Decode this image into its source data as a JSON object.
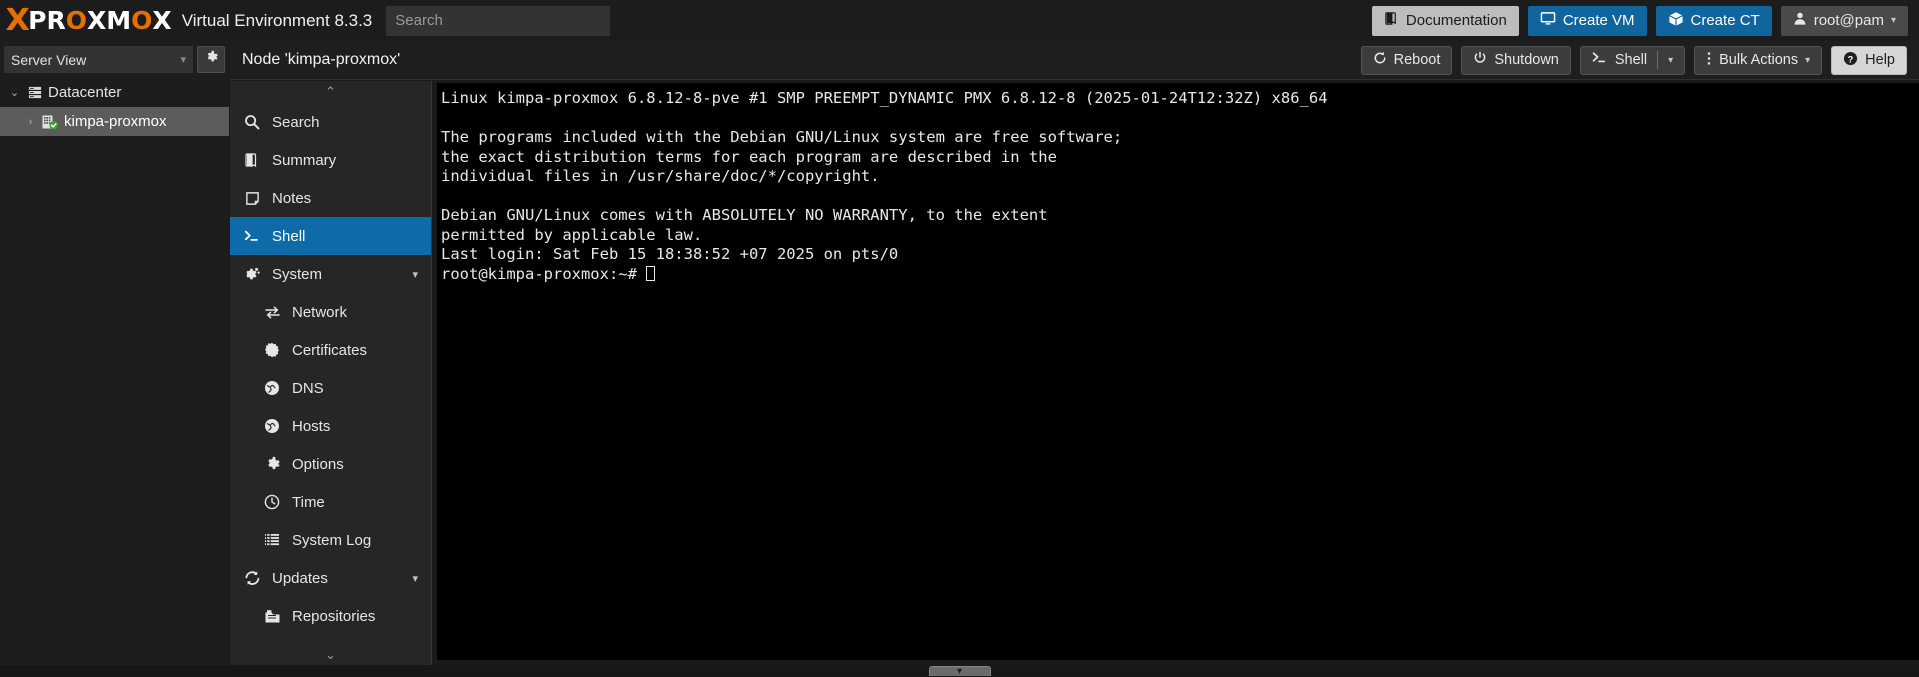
{
  "topbar": {
    "logo_mark": "X",
    "logo_word_parts": [
      {
        "text": "PR",
        "color": "white"
      },
      {
        "text": "O",
        "color": "orange"
      },
      {
        "text": "XM",
        "color": "white"
      },
      {
        "text": "O",
        "color": "orange"
      },
      {
        "text": "X",
        "color": "white"
      }
    ],
    "product_name": "Virtual Environment 8.3.3",
    "search": {
      "value": "",
      "placeholder": "Search"
    },
    "buttons": [
      {
        "label": "Documentation",
        "icon": "book-icon",
        "style": "gray"
      },
      {
        "label": "Create VM",
        "icon": "monitor-icon",
        "style": "blue"
      },
      {
        "label": "Create CT",
        "icon": "box-icon",
        "style": "blue"
      },
      {
        "label": "root@pam",
        "icon": "user-icon",
        "style": "dark",
        "caret": "▾"
      }
    ]
  },
  "tree": {
    "view_selector": {
      "label": "Server View",
      "chevron": "▾"
    },
    "settings_icon": "gear-icon",
    "items": [
      {
        "label": "Datacenter",
        "icon": "datacenter-icon",
        "arrow": "⌄",
        "level": 0,
        "selected": false
      },
      {
        "label": "kimpa-proxmox",
        "icon": "node-icon",
        "arrow": "›",
        "level": 1,
        "selected": true,
        "status": "online"
      }
    ]
  },
  "content": {
    "node_title": "Node 'kimpa-proxmox'",
    "actions": [
      {
        "label": "Reboot",
        "icon": "reboot-icon",
        "style": "dark",
        "split": false
      },
      {
        "label": "Shutdown",
        "icon": "power-icon",
        "style": "dark",
        "split": false
      },
      {
        "label": "Shell",
        "icon": "shell-icon",
        "style": "dark",
        "split": true,
        "caret": "▾"
      },
      {
        "label": "Bulk Actions",
        "icon": "kebab-icon",
        "style": "dark",
        "split": false,
        "caret": "▾"
      },
      {
        "label": "Help",
        "icon": "help-icon",
        "style": "light",
        "split": false
      }
    ]
  },
  "nav": {
    "scroll_up": "⌃",
    "scroll_down": "⌄",
    "items": [
      {
        "label": "Search",
        "icon": "search-icon",
        "sub": false,
        "active": false
      },
      {
        "label": "Summary",
        "icon": "summary-icon",
        "sub": false,
        "active": false
      },
      {
        "label": "Notes",
        "icon": "notes-icon",
        "sub": false,
        "active": false
      },
      {
        "label": "Shell",
        "icon": "shell-icon",
        "sub": false,
        "active": true
      },
      {
        "label": "System",
        "icon": "system-icon",
        "sub": false,
        "active": false,
        "caret": "▾"
      },
      {
        "label": "Network",
        "icon": "network-icon",
        "sub": true,
        "active": false
      },
      {
        "label": "Certificates",
        "icon": "certificate-icon",
        "sub": true,
        "active": false
      },
      {
        "label": "DNS",
        "icon": "globe-icon",
        "sub": true,
        "active": false
      },
      {
        "label": "Hosts",
        "icon": "globe-icon",
        "sub": true,
        "active": false
      },
      {
        "label": "Options",
        "icon": "gear-icon",
        "sub": true,
        "active": false
      },
      {
        "label": "Time",
        "icon": "clock-icon",
        "sub": true,
        "active": false
      },
      {
        "label": "System Log",
        "icon": "list-icon",
        "sub": true,
        "active": false
      },
      {
        "label": "Updates",
        "icon": "refresh-icon",
        "sub": false,
        "active": false,
        "caret": "▾"
      },
      {
        "label": "Repositories",
        "icon": "repository-icon",
        "sub": true,
        "active": false
      }
    ]
  },
  "terminal": {
    "lines": [
      "Linux kimpa-proxmox 6.8.12-8-pve #1 SMP PREEMPT_DYNAMIC PMX 6.8.12-8 (2025-01-24T12:32Z) x86_64",
      "",
      "The programs included with the Debian GNU/Linux system are free software;",
      "the exact distribution terms for each program are described in the",
      "individual files in /usr/share/doc/*/copyright.",
      "",
      "Debian GNU/Linux comes with ABSOLUTELY NO WARRANTY, to the extent",
      "permitted by applicable law.",
      "Last login: Sat Feb 15 18:38:52 +07 2025 on pts/0"
    ],
    "prompt": "root@kimpa-proxmox:~# "
  },
  "footer": {
    "tasklog_handle_icon": "▾"
  },
  "colors": {
    "accent_blue": "#0f6ba8",
    "brand_orange": "#e57000",
    "button_blue": "#11659e",
    "status_green": "#2fa82f",
    "terminal_bg": "#000000"
  }
}
